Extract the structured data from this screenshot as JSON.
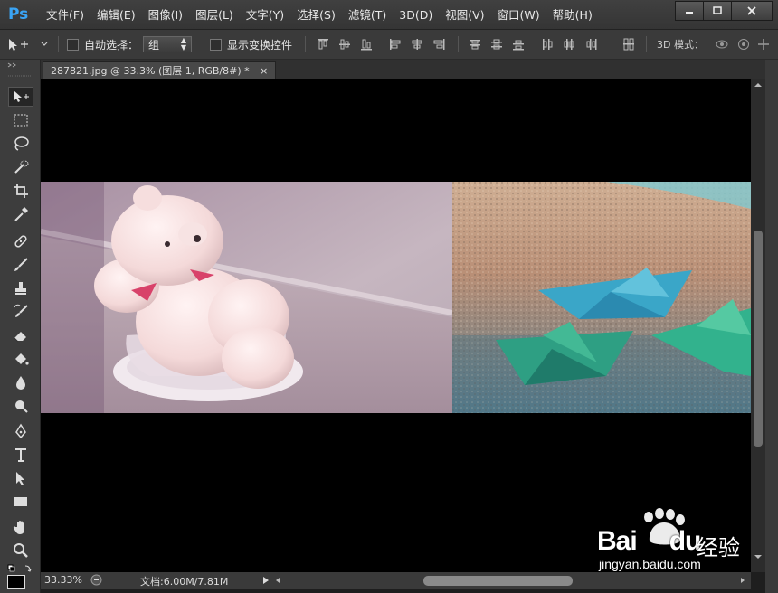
{
  "app": {
    "logo": "Ps"
  },
  "menu": [
    "文件(F)",
    "编辑(E)",
    "图像(I)",
    "图层(L)",
    "文字(Y)",
    "选择(S)",
    "滤镜(T)",
    "3D(D)",
    "视图(V)",
    "窗口(W)",
    "帮助(H)"
  ],
  "options": {
    "auto_select_label": "自动选择：",
    "auto_select_value": "组",
    "show_transform_label": "显示变换控件",
    "mode_3d_label": "3D 模式："
  },
  "document": {
    "tab_title": "287821.jpg @ 33.3% (图层 1, RGB/8#) *",
    "close_glyph": "×"
  },
  "status": {
    "zoom": "33.33%",
    "doc_size": "文档:6.00M/7.81M"
  },
  "watermark": {
    "brand": "Bai",
    "brand2": "du",
    "cn": "经验",
    "url": "jingyan.baidu.com"
  },
  "colors": {
    "accent": "#3aa4f5",
    "canvas": "#000000",
    "chrome": "#3a3a3a"
  }
}
